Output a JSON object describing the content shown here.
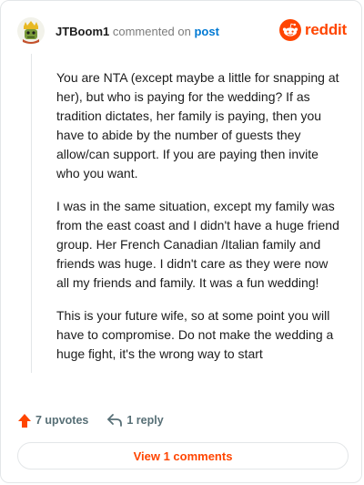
{
  "header": {
    "username": "JTBoom1",
    "action_text": "commented on",
    "post_link": "post",
    "brand": "reddit"
  },
  "comment": {
    "paragraphs": [
      "You are NTA (except maybe a little for snapping at her), but who is paying for the wedding? If as tradition dictates, her family is paying, then you have to abide by the number of guests they allow/can support. If you are paying then invite who you want.",
      "I was in the same situation, except my family was from the east coast and I didn't have a huge friend group. Her French Canadian /Italian family and friends was huge. I didn't care as they were now all my friends and family. It was a fun wedding!",
      "This is your future wife, so at some point you will have to compromise. Do not make the wedding a huge fight, it's the wrong way to start"
    ]
  },
  "actions": {
    "upvotes_label": "7 upvotes",
    "reply_label": "1 reply"
  },
  "view_comments_label": "View 1 comments",
  "colors": {
    "brand": "#ff4500",
    "link": "#0079d3",
    "muted": "#576f76"
  }
}
